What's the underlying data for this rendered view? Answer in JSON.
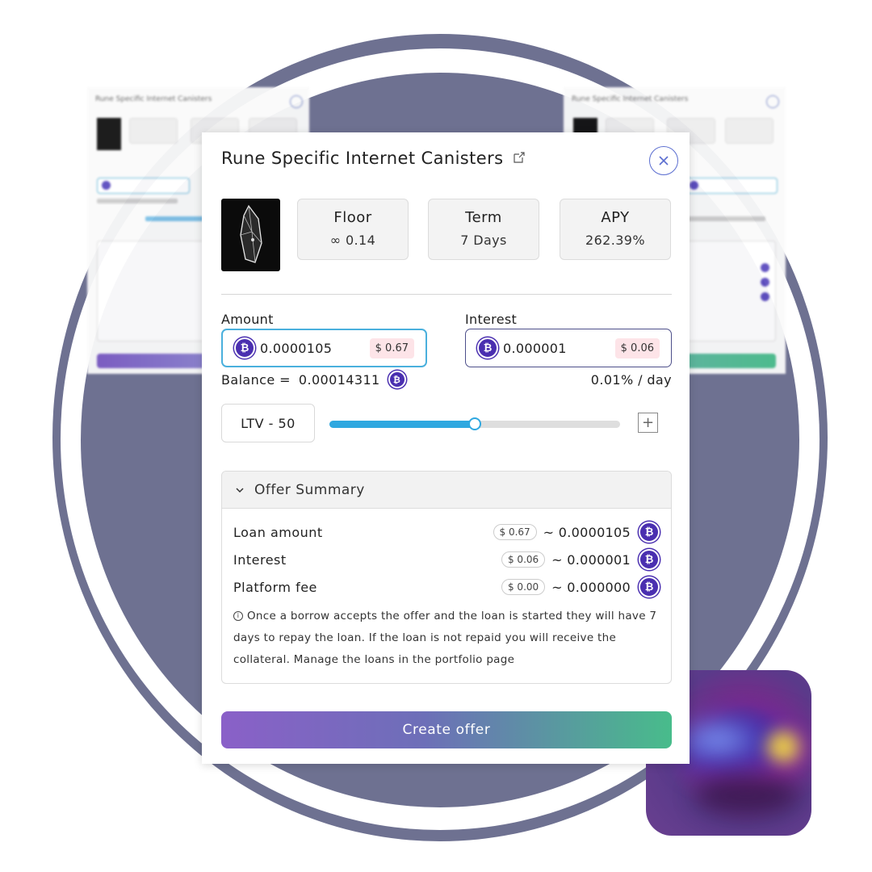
{
  "modal": {
    "title": "Rune Specific Internet Canisters",
    "stats": {
      "floor_label": "Floor",
      "floor_value": "∞ 0.14",
      "term_label": "Term",
      "term_value": "7 Days",
      "apy_label": "APY",
      "apy_value": "262.39%"
    },
    "amount": {
      "label": "Amount",
      "value": "0.0000105",
      "usd": "$ 0.67"
    },
    "interest": {
      "label": "Interest",
      "value": "0.000001",
      "usd": "$ 0.06"
    },
    "balance": {
      "label": "Balance =",
      "value": "0.00014311"
    },
    "rate": "0.01% / day",
    "ltv": {
      "label": "LTV - 50",
      "slider_fraction": 0.5,
      "plus": "+"
    },
    "summary": {
      "title": "Offer Summary",
      "rows": [
        {
          "name": "Loan amount",
          "usd": "$ 0.67",
          "approx": "~ 0.0000105"
        },
        {
          "name": "Interest",
          "usd": "$ 0.06",
          "approx": "~ 0.000001"
        },
        {
          "name": "Platform fee",
          "usd": "$ 0.00",
          "approx": "~ 0.000000"
        }
      ],
      "note": "Once a borrow accepts the offer and the loan is started they will have 7 days to repay the loan. If the loan is not repaid you will receive the collateral. Manage the loans in the portfolio page"
    },
    "cta": "Create offer"
  },
  "background_cards": {
    "left_title": "Rune Specific Internet Canisters",
    "right_title": "Rune Specific Internet Canisters"
  },
  "colors": {
    "ring": "#6e7191",
    "accent_blue": "#2fa8e0",
    "coin": "#4a2fb0",
    "usd_badge": "#fde4e8"
  },
  "icons": {
    "coin": "bitcoin-coin-icon",
    "external": "external-link-icon",
    "close": "close-icon",
    "chevron": "chevron-down-icon",
    "info": "info-icon"
  }
}
